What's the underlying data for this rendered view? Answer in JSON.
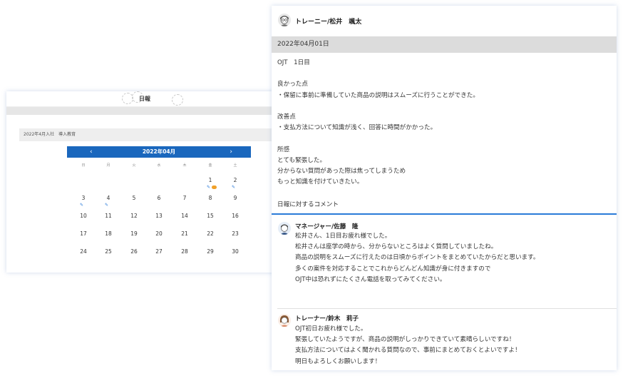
{
  "calendar": {
    "header_title": "日報",
    "sub_label": "2022年4月入社　導入教育",
    "month_label": "2022年04月",
    "prev": "‹",
    "next": "›",
    "weekdays": [
      "日",
      "月",
      "火",
      "水",
      "木",
      "金",
      "土"
    ],
    "rows": [
      [
        "",
        "",
        "",
        "",
        "",
        "1",
        "2"
      ],
      [
        "3",
        "4",
        "5",
        "6",
        "7",
        "8",
        "9"
      ],
      [
        "10",
        "11",
        "12",
        "13",
        "14",
        "15",
        "16"
      ],
      [
        "17",
        "18",
        "19",
        "20",
        "21",
        "22",
        "23"
      ],
      [
        "24",
        "25",
        "26",
        "27",
        "28",
        "29",
        "30"
      ]
    ],
    "accent": "#1a67bd"
  },
  "diary": {
    "author": "トレーニー/松井　颯太",
    "date": "2022年04月01日",
    "body": "OJT　1日目\n\n良かった点\n・保留に事前に準備していた商品の説明はスムーズに行うことができた。\n\n改善点\n・支払方法について知識が浅く、回答に時間がかかった。\n\n所感\nとても緊張した。\n分からない質問があった際は焦ってしまうため\nもっと知識を付けていきたい。",
    "comments_title": "日報に対するコメント",
    "comments": [
      {
        "author": "マネージャー/佐藤　隆",
        "body": "松井さん、1日目お疲れ様でした。\n松井さんは座学の時から、分からないところはよく質問していましたね。\n商品の説明をスムーズに行えたのは日頃からポイントをまとめていたからだと思います。\n多くの案件を対応することでこれからどんどん知識が身に付きますので\nOJT中は恐れずにたくさん電話を取ってみてください。"
      },
      {
        "author": "トレーナー/鈴木　莉子",
        "body": "OJT初日お疲れ様でした。\n緊張していたようですが、商品の説明がしっかりできていて素晴らしいですね！\n支払方法についてはよく聞かれる質問なので、事前にまとめておくとよいですよ！\n明日もよろしくお願いします！"
      }
    ]
  }
}
